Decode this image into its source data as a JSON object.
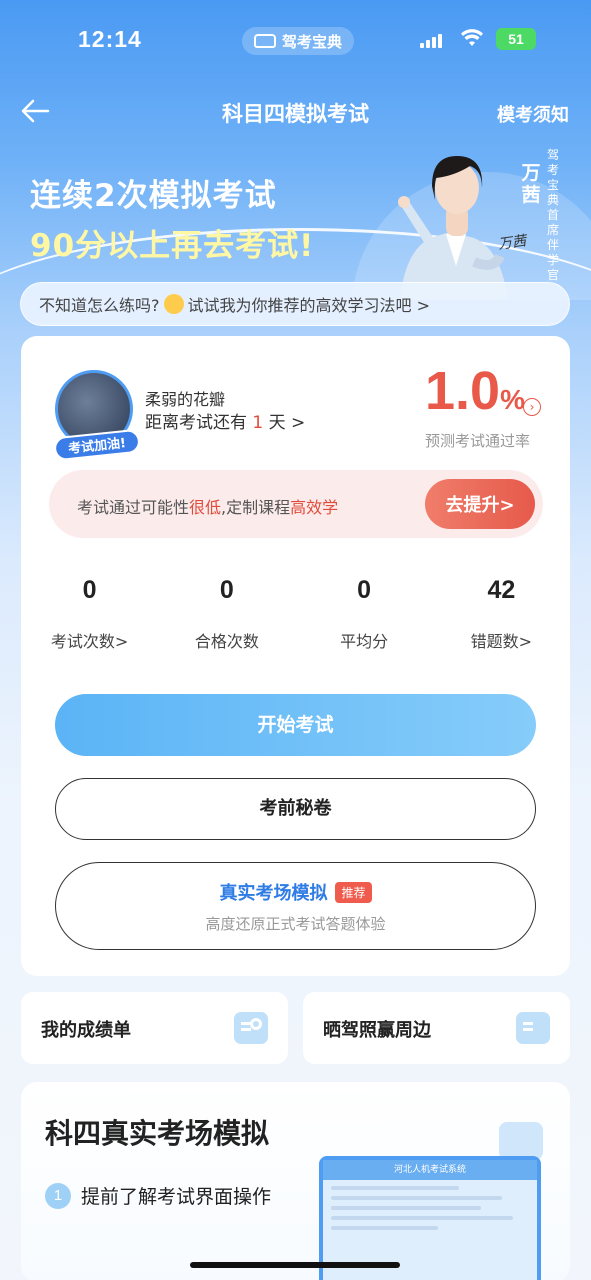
{
  "status_bar": {
    "time": "12:14",
    "app_name": "驾考宝典",
    "battery": "51"
  },
  "nav": {
    "title": "科目四模拟考试",
    "right_link": "模考须知"
  },
  "banner": {
    "headline1": "连续2次模拟考试",
    "headline2": "90分以上再去考试!",
    "person_name": "万茜",
    "person_title": "驾考宝典首席伴学官",
    "signature": "万茜"
  },
  "tip": {
    "text_before": "不知道怎么练吗?",
    "text_after": "试试我为你推荐的高效学习法吧 >"
  },
  "profile": {
    "avatar_badge": "考试加油!",
    "user_name": "柔弱的花瓣",
    "countdown_prefix": "距离考试还有 ",
    "countdown_days": "1",
    "countdown_suffix": " 天 >",
    "pass_rate": "1.0",
    "pass_rate_unit": "%",
    "pass_rate_label": "预测考试通过率"
  },
  "alert": {
    "part1": "考试通过可能性",
    "part2": "很低",
    "part3": ",定制课程",
    "part4": "高效学",
    "button": "去提升>"
  },
  "stats": [
    {
      "value": "0",
      "label": "考试次数>"
    },
    {
      "value": "0",
      "label": "合格次数"
    },
    {
      "value": "0",
      "label": "平均分"
    },
    {
      "value": "42",
      "label": "错题数>"
    }
  ],
  "buttons": {
    "start": "开始考试",
    "secret": "考前秘卷",
    "sim_title": "真实考场模拟",
    "sim_badge": "推荐",
    "sim_sub": "高度还原正式考试答题体验"
  },
  "mini_cards": {
    "left": "我的成绩单",
    "right": "晒驾照赢周边"
  },
  "sim_section": {
    "title": "科四真实考场模拟",
    "step1_num": "1",
    "step1_text": "提前了解考试界面操作",
    "preview_header": "河北人机考试系统"
  },
  "colors": {
    "primary_blue": "#4a9af3",
    "accent_red": "#e8594a",
    "sim_blue": "#2f7ce5"
  }
}
